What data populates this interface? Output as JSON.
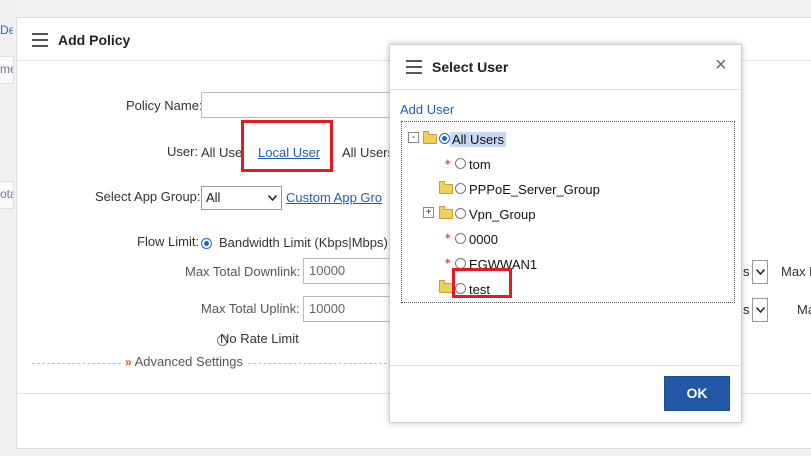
{
  "background": {
    "strip_texts": [
      "Del",
      "me",
      "ota"
    ]
  },
  "panel": {
    "title": "Add Policy",
    "policy_name_label": "Policy Name:",
    "policy_name_value": "",
    "user_label": "User:",
    "user_all_users": "All Users",
    "user_local_user": "Local User",
    "user_all_users_2": "All Users",
    "app_group_label": "Select App Group:",
    "app_group_value": "All",
    "custom_app_group_link": "Custom App Gro",
    "flow_limit_label": "Flow Limit:",
    "bandwidth_limit_label": "Bandwidth Limit (Kbps|Mbps)",
    "max_total_downlink_label": "Max Total Downlink:",
    "max_total_downlink_value": "10000",
    "max_total_uplink_label": "Max Total Uplink:",
    "max_total_uplink_value": "10000",
    "no_rate_limit_label": "No Rate Limit",
    "advanced_settings_label": "Advanced Settings",
    "right_unit_1": "s",
    "right_label_1": "Max D",
    "right_unit_2": "s",
    "right_label_2": "Ma"
  },
  "dialog": {
    "title": "Select User",
    "add_user_link": "Add User",
    "tree": {
      "root": "All Users",
      "tom": "tom",
      "pppoe": "PPPoE_Server_Group",
      "vpn": "Vpn_Group",
      "n0000": "0000",
      "egwwan1": "EGWWAN1",
      "test": "test"
    },
    "ok_label": "OK",
    "close_glyph": "×"
  },
  "colors": {
    "accent": "#2158a8",
    "link": "#1f5fb0",
    "highlight": "#e01b22"
  }
}
